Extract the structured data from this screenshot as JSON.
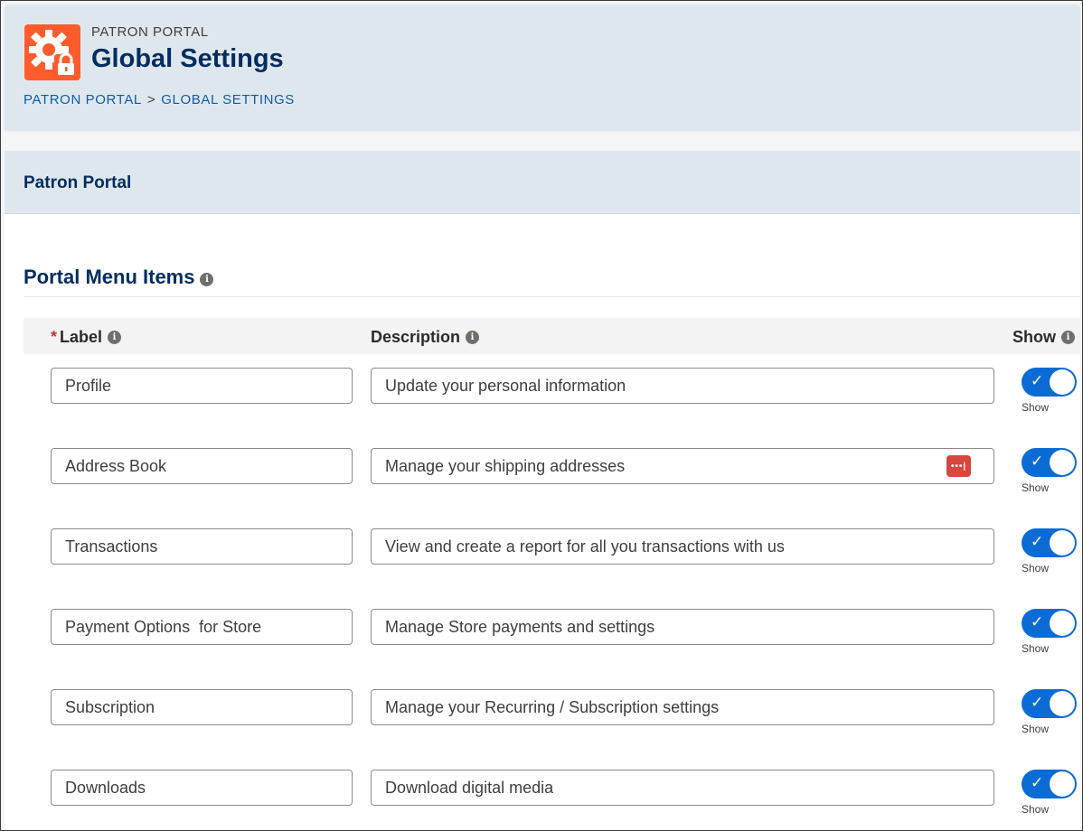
{
  "header": {
    "eyebrow": "PATRON PORTAL",
    "title": "Global Settings",
    "icon": "settings-lock-icon",
    "icon_color": "#fe5c2c",
    "breadcrumb": [
      "PATRON PORTAL",
      "GLOBAL SETTINGS"
    ],
    "breadcrumb_separator": ">"
  },
  "card": {
    "title": "Patron Portal",
    "section_title": "Portal Menu Items",
    "columns": {
      "label": "Label",
      "description": "Description",
      "show": "Show"
    },
    "required_marker": "*",
    "info_glyph": "i",
    "toggle_accent": "#0b6bd5"
  },
  "menu_items": [
    {
      "label": "Profile",
      "description": "Update your personal information",
      "show": true,
      "show_text": "Show"
    },
    {
      "label": "Address Book",
      "description": "Manage your shipping addresses",
      "show": true,
      "show_text": "Show"
    },
    {
      "label": "Transactions",
      "description": "View and create a report for all you transactions with us",
      "show": true,
      "show_text": "Show"
    },
    {
      "label": "Payment Options  for Store",
      "description": "Manage Store payments and settings",
      "show": true,
      "show_text": "Show"
    },
    {
      "label": "Subscription",
      "description": "Manage your Recurring / Subscription settings",
      "show": true,
      "show_text": "Show"
    },
    {
      "label": "Downloads",
      "description": "Download digital media",
      "show": true,
      "show_text": "Show"
    }
  ]
}
